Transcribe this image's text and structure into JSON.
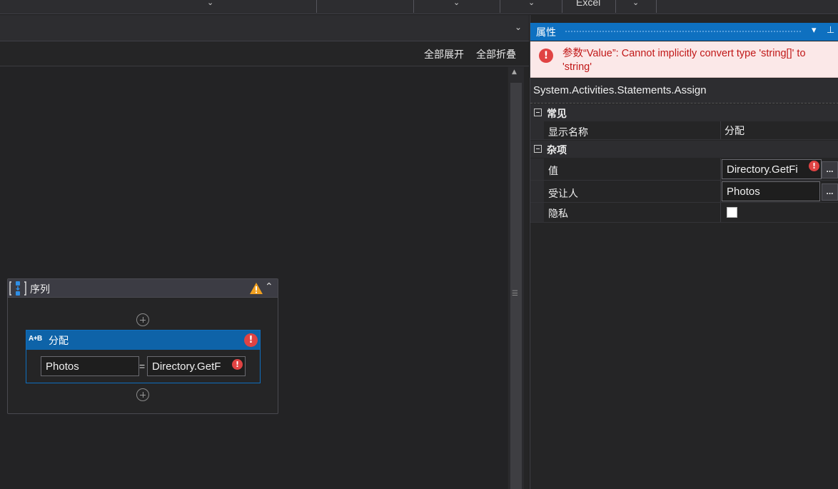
{
  "toolbar": {
    "excel_label": "Excel"
  },
  "designer": {
    "expand_all": "全部展开",
    "collapse_all": "全部折叠",
    "sequence": {
      "title": "序列",
      "assign": {
        "title": "分配",
        "icon_text": "A+B",
        "to_value": "Photos",
        "equals": "=",
        "value_expr": "Directory.GetF"
      }
    }
  },
  "properties": {
    "title": "属性",
    "error_message": "参数“Value”: Cannot implicitly convert type 'string[]' to 'string'",
    "type_name": "System.Activities.Statements.Assign",
    "categories": [
      {
        "label": "常见",
        "rows": [
          {
            "name": "显示名称",
            "value": "分配"
          }
        ]
      },
      {
        "label": "杂项",
        "rows": [
          {
            "name": "值",
            "value": "Directory.GetFi"
          },
          {
            "name": "受让人",
            "value": "Photos"
          },
          {
            "name": "隐私",
            "value": ""
          }
        ]
      }
    ],
    "ellipsis_label": "...",
    "privacy_checked": false
  },
  "icons": {
    "error": "!",
    "pin": "pin-icon",
    "dropdown": "chevron-down-icon",
    "warning": "warning-icon",
    "collapse": "double-chevron-up-icon"
  },
  "colors": {
    "accent": "#0e70c0",
    "error": "#e04343",
    "error_bg": "#fbe8e8",
    "error_text": "#c11818",
    "warning": "#f0a020"
  }
}
